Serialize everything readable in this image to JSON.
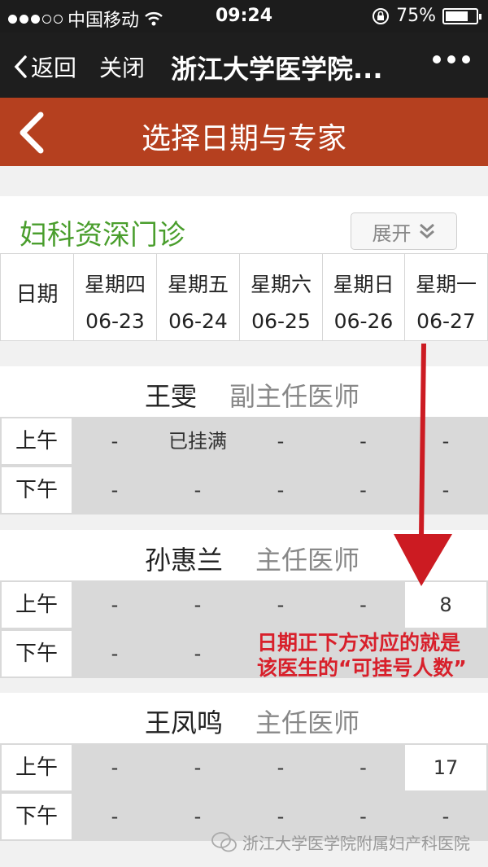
{
  "status": {
    "carrier": "中国移动",
    "time": "09:24",
    "battery_text": "75%",
    "battery_level": 0.75
  },
  "nav": {
    "back_label": "返回",
    "close_label": "关闭",
    "title": "浙江大学医学院..."
  },
  "page": {
    "title": "选择日期与专家"
  },
  "section": {
    "title": "妇科资深门诊",
    "expand_label": "展开"
  },
  "schedule": {
    "date_header": "日期",
    "days": [
      {
        "weekday": "星期四",
        "date": "06-23"
      },
      {
        "weekday": "星期五",
        "date": "06-24"
      },
      {
        "weekday": "星期六",
        "date": "06-25"
      },
      {
        "weekday": "星期日",
        "date": "06-26"
      },
      {
        "weekday": "星期一",
        "date": "06-27"
      }
    ]
  },
  "slot_labels": {
    "am": "上午",
    "pm": "下午"
  },
  "doctors": [
    {
      "name": "王雯",
      "rank": "副主任医师",
      "am": [
        "-",
        "已挂满",
        "-",
        "-",
        "-"
      ],
      "pm": [
        "-",
        "-",
        "-",
        "-",
        "-"
      ]
    },
    {
      "name": "孙惠兰",
      "rank": "主任医师",
      "am": [
        "-",
        "-",
        "-",
        "-",
        "8"
      ],
      "pm": [
        "-",
        "-",
        "",
        "",
        ""
      ]
    },
    {
      "name": "王凤鸣",
      "rank": "主任医师",
      "am": [
        "-",
        "-",
        "-",
        "-",
        "17"
      ],
      "pm": [
        "-",
        "-",
        "-",
        "-",
        "-"
      ]
    }
  ],
  "annotation": {
    "line1": "日期正下方对应的就是",
    "line2": "该医生的“可挂号人数”",
    "color": "#d8202b"
  },
  "watermark": {
    "text": "浙江大学医学院附属妇产科医院"
  }
}
